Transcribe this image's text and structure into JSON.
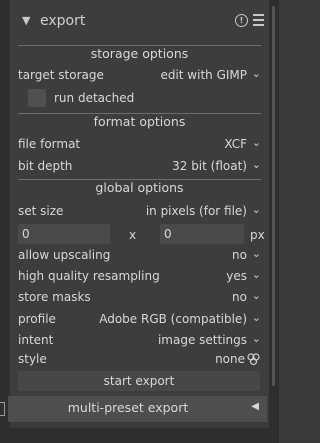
{
  "header": {
    "title": "export",
    "reset_icon": "reset-icon",
    "menu_icon": "presets-menu-icon"
  },
  "sections": {
    "storage": "storage options",
    "format": "format options",
    "global": "global options"
  },
  "storage": {
    "target_label": "target storage",
    "target_value": "edit with GIMP",
    "run_detached_label": "run detached",
    "run_detached_checked": false
  },
  "format": {
    "file_format_label": "file format",
    "file_format_value": "XCF",
    "bit_depth_label": "bit depth",
    "bit_depth_value": "32 bit (float)"
  },
  "global": {
    "set_size_label": "set size",
    "set_size_value": "in pixels (for file)",
    "width_value": "0",
    "x_label": "x",
    "height_value": "0",
    "unit_label": "px",
    "allow_upscaling_label": "allow upscaling",
    "allow_upscaling_value": "no",
    "hq_resampling_label": "high quality resampling",
    "hq_resampling_value": "yes",
    "store_masks_label": "store masks",
    "store_masks_value": "no",
    "profile_label": "profile",
    "profile_value": "Adobe RGB (compatible)",
    "intent_label": "intent",
    "intent_value": "image settings",
    "style_label": "style",
    "style_value": "none"
  },
  "buttons": {
    "start_export": "start export",
    "multi_preset_export": "multi-preset export"
  }
}
